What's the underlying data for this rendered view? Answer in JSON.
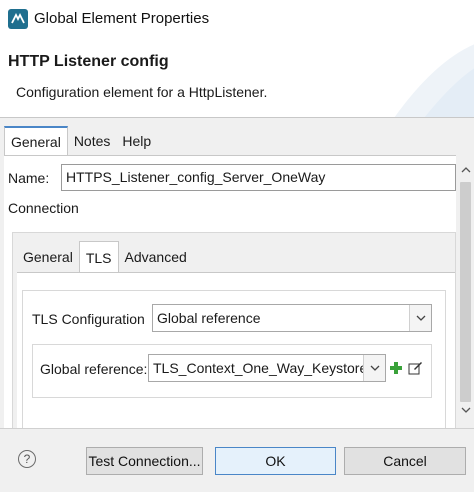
{
  "window": {
    "title": "Global Element Properties"
  },
  "header": {
    "title": "HTTP Listener config",
    "description": "Configuration element for a HttpListener."
  },
  "top_tabs": [
    {
      "label": "General",
      "active": true
    },
    {
      "label": "Notes",
      "active": false
    },
    {
      "label": "Help",
      "active": false
    }
  ],
  "general": {
    "name_label": "Name:",
    "name_value": "HTTPS_Listener_config_Server_OneWay",
    "connection_label": "Connection"
  },
  "connection_tabs": [
    {
      "label": "General",
      "active": false
    },
    {
      "label": "TLS",
      "active": true
    },
    {
      "label": "Advanced",
      "active": false
    }
  ],
  "tls": {
    "config_label": "TLS Configuration",
    "config_value": "Global reference",
    "ref_label": "Global reference:",
    "ref_value": "TLS_Context_One_Way_Keystore"
  },
  "footer": {
    "help_symbol": "?",
    "test_label": "Test Connection...",
    "ok_label": "OK",
    "cancel_label": "Cancel"
  },
  "colors": {
    "accent": "#4a86c7",
    "add_icon": "#3aa23a"
  }
}
